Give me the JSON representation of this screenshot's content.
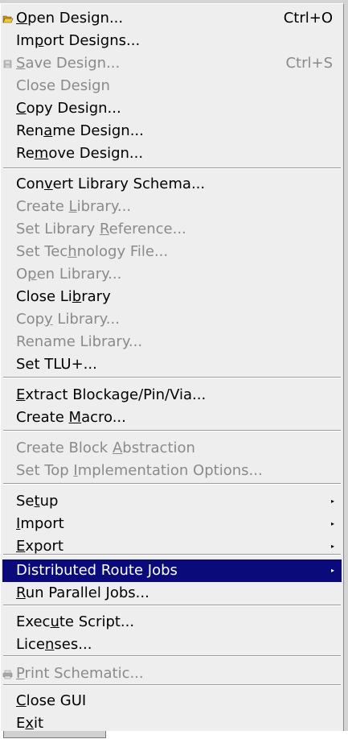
{
  "menu": {
    "items": [
      {
        "name": "menu-item-open-design",
        "pre": "",
        "u": "O",
        "post": "pen Design...",
        "accel": "Ctrl+O",
        "enabled": true,
        "icon": "folder-open-icon"
      },
      {
        "name": "menu-item-import-designs",
        "pre": "Im",
        "u": "p",
        "post": "ort Designs...",
        "accel": "",
        "enabled": true
      },
      {
        "name": "menu-item-save-design",
        "pre": "",
        "u": "S",
        "post": "ave Design...",
        "accel": "Ctrl+S",
        "enabled": false,
        "icon": "save-icon"
      },
      {
        "name": "menu-item-close-design",
        "pre": "Close Design",
        "u": "",
        "post": "",
        "accel": "",
        "enabled": false
      },
      {
        "name": "menu-item-copy-design",
        "pre": "",
        "u": "C",
        "post": "opy Design...",
        "accel": "",
        "enabled": true
      },
      {
        "name": "menu-item-rename-design",
        "pre": "Ren",
        "u": "a",
        "post": "me Design...",
        "accel": "",
        "enabled": true
      },
      {
        "name": "menu-item-remove-design",
        "pre": "Re",
        "u": "m",
        "post": "ove Design...",
        "accel": "",
        "enabled": true
      },
      {
        "name": "menu-item-convert-library-schema",
        "pre": "Con",
        "u": "v",
        "post": "ert Library Schema...",
        "accel": "",
        "enabled": true
      },
      {
        "name": "menu-item-create-library",
        "pre": "Create ",
        "u": "L",
        "post": "ibrary...",
        "accel": "",
        "enabled": false
      },
      {
        "name": "menu-item-set-library-reference",
        "pre": "Set Library ",
        "u": "R",
        "post": "eference...",
        "accel": "",
        "enabled": false
      },
      {
        "name": "menu-item-set-technology-file",
        "pre": "Set Tec",
        "u": "h",
        "post": "nology File...",
        "accel": "",
        "enabled": false
      },
      {
        "name": "menu-item-open-library",
        "pre": "O",
        "u": "p",
        "post": "en Library...",
        "accel": "",
        "enabled": false
      },
      {
        "name": "menu-item-close-library",
        "pre": "Close Li",
        "u": "b",
        "post": "rary",
        "accel": "",
        "enabled": true
      },
      {
        "name": "menu-item-copy-library",
        "pre": "Cop",
        "u": "y",
        "post": " Library...",
        "accel": "",
        "enabled": false
      },
      {
        "name": "menu-item-rename-library",
        "pre": "Rename Library...",
        "u": "",
        "post": "",
        "accel": "",
        "enabled": false
      },
      {
        "name": "menu-item-set-tlu",
        "pre": "Set TLU+...",
        "u": "",
        "post": "",
        "accel": "",
        "enabled": true
      },
      {
        "name": "menu-item-extract-blockage",
        "pre": "",
        "u": "E",
        "post": "xtract Blockage/Pin/Via...",
        "accel": "",
        "enabled": true
      },
      {
        "name": "menu-item-create-macro",
        "pre": "Create ",
        "u": "M",
        "post": "acro...",
        "accel": "",
        "enabled": true
      },
      {
        "name": "menu-item-create-block-abstraction",
        "pre": "Create Block ",
        "u": "A",
        "post": "bstraction",
        "accel": "",
        "enabled": false
      },
      {
        "name": "menu-item-set-top-implementation-options",
        "pre": "Set Top ",
        "u": "I",
        "post": "mplementation Options...",
        "accel": "",
        "enabled": false
      },
      {
        "name": "menu-item-setup",
        "pre": "Se",
        "u": "t",
        "post": "up",
        "accel": "",
        "enabled": true,
        "submenu": true
      },
      {
        "name": "menu-item-import",
        "pre": "",
        "u": "I",
        "post": "mport",
        "accel": "",
        "enabled": true,
        "submenu": true
      },
      {
        "name": "menu-item-export",
        "pre": "",
        "u": "E",
        "post": "xport",
        "accel": "",
        "enabled": true,
        "submenu": true
      },
      {
        "name": "menu-item-distributed-route-jobs",
        "pre": "Distributed Route ",
        "u": "J",
        "post": "obs",
        "accel": "",
        "enabled": true,
        "submenu": true,
        "selected": true
      },
      {
        "name": "menu-item-run-parallel-jobs",
        "pre": "",
        "u": "R",
        "post": "un Parallel Jobs...",
        "accel": "",
        "enabled": true
      },
      {
        "name": "menu-item-execute-script",
        "pre": "Exec",
        "u": "u",
        "post": "te Script...",
        "accel": "",
        "enabled": true
      },
      {
        "name": "menu-item-licenses",
        "pre": "Lice",
        "u": "n",
        "post": "ses...",
        "accel": "",
        "enabled": true
      },
      {
        "name": "menu-item-print-schematic",
        "pre": "",
        "u": "P",
        "post": "rint Schematic...",
        "accel": "",
        "enabled": false,
        "icon": "printer-icon"
      },
      {
        "name": "menu-item-close-gui",
        "pre": "",
        "u": "C",
        "post": "lose GUI",
        "accel": "",
        "enabled": true
      },
      {
        "name": "menu-item-exit",
        "pre": "E",
        "u": "x",
        "post": "it",
        "accel": "",
        "enabled": true
      }
    ]
  },
  "colors": {
    "menu_bg": "#eeeeee",
    "disabled_text": "#8a8a8a",
    "selected_bg": "#0a0a7a",
    "selected_text": "#ffffff",
    "folder_icon": "#d8b030"
  }
}
